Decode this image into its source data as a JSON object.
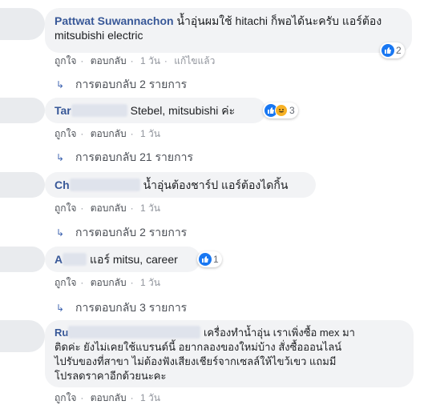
{
  "comments": [
    {
      "name": "Pattwat Suwannachon",
      "text": "น้ำอุ่นผมใช้ hitachi ก็พอได้นะครับ แอร์ต้อง mitsubishi electric",
      "actions": [
        "ถูกใจ",
        "ตอบกลับ",
        "1 วัน",
        "แก้ไขแล้ว"
      ],
      "reactions": {
        "icons": [
          "like-icon"
        ],
        "count": "2"
      },
      "replies_label": "การตอบกลับ 2 รายการ"
    },
    {
      "name": "Tar",
      "text": "Stebel, mitsubishi ค่ะ",
      "actions": [
        "ถูกใจ",
        "ตอบกลับ",
        "1 วัน"
      ],
      "reactions": {
        "icons": [
          "like-icon",
          "haha-icon"
        ],
        "count": "3"
      },
      "replies_label": "การตอบกลับ 21 รายการ"
    },
    {
      "name": "Ch",
      "text": "น้ำอุ่นต้องชาร์ป แอร์ต้องไดกิ้น",
      "actions": [
        "ถูกใจ",
        "ตอบกลับ",
        "1 วัน"
      ],
      "replies_label": "การตอบกลับ 2 รายการ"
    },
    {
      "name": "A",
      "text": "แอร์ mitsu, career",
      "actions": [
        "ถูกใจ",
        "ตอบกลับ",
        "1 วัน"
      ],
      "reactions": {
        "icons": [
          "like-icon"
        ],
        "count": "1"
      },
      "replies_label": "การตอบกลับ 3 รายการ"
    },
    {
      "name": "Ru",
      "text_lines": [
        "เครื่องทำน้ำอุ่น เราเพิ่งซื้อ mex มา",
        "ติดค่ะ ยังไม่เคยใช้แบรนด์นี้ อยากลองของใหม่บ้าง สั่งซื้อออนไลน์",
        "ไปรับของที่สาขา ไม่ต้องฟังเสียงเชียร์จากเซลล์ให้ไขว้เขว แถมมี",
        "โปรลดราคาอีกด้วยนะคะ"
      ],
      "actions": [
        "ถูกใจ",
        "ตอบกลับ",
        "1 วัน"
      ]
    }
  ],
  "colors": {
    "link": "#385898",
    "like": "#1877f2",
    "bubble": "#f2f3f5"
  }
}
